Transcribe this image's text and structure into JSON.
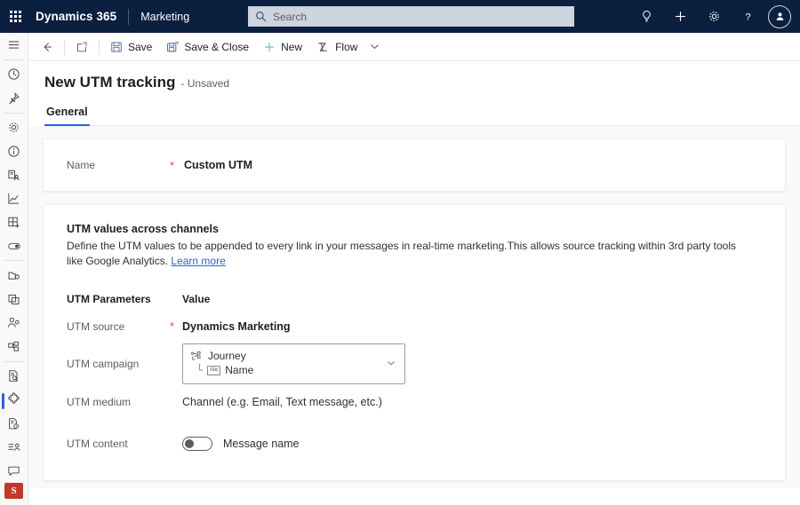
{
  "topbar": {
    "waffle_label": "app-launcher",
    "brand": "Dynamics 365",
    "app_name": "Marketing",
    "search": {
      "placeholder": "Search",
      "value": ""
    },
    "icons": [
      {
        "name": "lightbulb-icon",
        "label": "Tips"
      },
      {
        "name": "plus-icon",
        "label": "Quick create"
      },
      {
        "name": "gear-icon",
        "label": "Settings"
      },
      {
        "name": "help-icon",
        "label": "Help"
      }
    ],
    "avatar": {
      "name": "avatar",
      "initials": ""
    }
  },
  "rail": {
    "items": [
      {
        "name": "sidebar-item-menu",
        "icon": "hamburger-icon",
        "selected": false
      },
      {
        "name": "sidebar-item-recent",
        "icon": "clock-icon",
        "selected": false
      },
      {
        "name": "sidebar-item-pinned",
        "icon": "pin-icon",
        "selected": false
      },
      {
        "name": "sidebar-item-settings",
        "icon": "gear-icon",
        "selected": false
      },
      {
        "name": "sidebar-item-info",
        "icon": "info-icon",
        "selected": false
      },
      {
        "name": "sidebar-item-audience",
        "icon": "audience-icon",
        "selected": false
      },
      {
        "name": "sidebar-item-analytics",
        "icon": "line-chart-icon",
        "selected": false
      },
      {
        "name": "sidebar-item-grid-add",
        "icon": "grid-plus-icon",
        "selected": false
      },
      {
        "name": "sidebar-item-toggle",
        "icon": "toggle-icon",
        "selected": false
      },
      {
        "name": "sidebar-item-assets",
        "icon": "assets-icon",
        "selected": false
      },
      {
        "name": "sidebar-item-copy",
        "icon": "copy-icon",
        "selected": false
      },
      {
        "name": "sidebar-item-contacts",
        "icon": "person-icon",
        "selected": false
      },
      {
        "name": "sidebar-item-segments",
        "icon": "segments-icon",
        "selected": false
      },
      {
        "name": "sidebar-item-forms",
        "icon": "form-search-icon",
        "selected": false
      },
      {
        "name": "sidebar-item-extensions",
        "icon": "puzzle-icon",
        "selected": true
      },
      {
        "name": "sidebar-item-schedule",
        "icon": "doc-clock-icon",
        "selected": false
      },
      {
        "name": "sidebar-item-lists",
        "icon": "list-person-icon",
        "selected": false
      },
      {
        "name": "sidebar-item-chat",
        "icon": "chat-icon",
        "selected": false
      }
    ],
    "badge": {
      "name": "sales-app-badge",
      "text": "S"
    }
  },
  "commandbar": {
    "back_label": "Back",
    "popout_label": "Open in new window",
    "save_label": "Save",
    "save_close_label": "Save & Close",
    "new_label": "New",
    "flow_label": "Flow",
    "more_label": "More commands"
  },
  "page": {
    "title": "New UTM tracking",
    "subtitle": "- Unsaved",
    "tabs": [
      {
        "label": "General",
        "active": true
      }
    ]
  },
  "name_card": {
    "label": "Name",
    "required": "*",
    "value": "Custom UTM"
  },
  "utm_card": {
    "section_title": "UTM values across channels",
    "description": "Define the UTM values to be appended to every link in your messages in real-time marketing.This allows source tracking within 3rd party tools like Google Analytics.",
    "link_text": "Learn more",
    "table": {
      "header_param": "UTM Parameters",
      "header_value": "Value",
      "rows": [
        {
          "name": "row-utm-source",
          "label": "UTM source",
          "required": "*",
          "type": "text",
          "value": "Dynamics Marketing"
        },
        {
          "name": "row-utm-campaign",
          "label": "UTM campaign",
          "required": "",
          "type": "token",
          "token_primary": "Journey",
          "token_secondary": "Name",
          "token_primary_icon": "journey-icon",
          "token_secondary_icon": "abc-field-icon",
          "abc_text": "Abc"
        },
        {
          "name": "row-utm-medium",
          "label": "UTM medium",
          "required": "",
          "type": "plain",
          "value": "Channel (e.g. Email, Text message, etc.)"
        },
        {
          "name": "row-utm-content",
          "label": "UTM content",
          "required": "",
          "type": "toggle",
          "toggle_on": false,
          "value": "Message name"
        }
      ]
    }
  },
  "colors": {
    "topbar_bg": "#0b1f3f",
    "accent": "#2266e3",
    "required": "#e04b4b",
    "link": "#2a66c8",
    "badge_red": "#c0392b",
    "page_bg": "#faf9f8"
  }
}
